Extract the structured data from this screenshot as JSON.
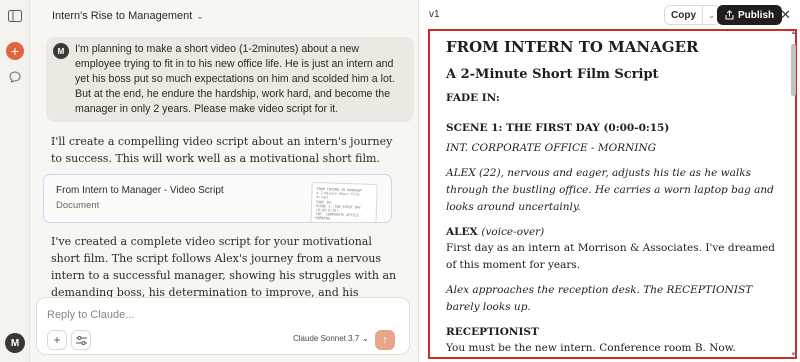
{
  "chat": {
    "title": "Intern's Rise to Management",
    "user_initial": "M",
    "user_message": "I'm planning to make a short video (1-2minutes) about a new employee trying to fit in to his new office life. He is just an intern and yet his boss put so much expectations on him and scolded him a lot. But at the end, he endure the hardship, work hard, and become the manager in only 2 years. Please make video script for it.",
    "response_1": "I'll create a compelling video script about an intern's journey to success. This will work well as a motivational short film.",
    "artifact_card": {
      "title": "From Intern to Manager - Video Script",
      "type": "Document"
    },
    "response_2": "I've created a complete video script for your motivational short film. The script follows Alex's journey from a nervous intern to a successful manager, showing his struggles with an demanding boss, his determination to improve, and his ultimate success."
  },
  "composer": {
    "placeholder": "Reply to Claude...",
    "model": "Claude Sonnet 3.7"
  },
  "rail": {
    "avatar_initial": "M"
  },
  "panel": {
    "version": "v1",
    "copy_label": "Copy",
    "publish_label": "Publish"
  },
  "script": {
    "title": "FROM INTERN TO MANAGER",
    "subtitle": "A 2-Minute Short Film Script",
    "fade_in": "FADE IN:",
    "scene1_heading": "SCENE 1: THE FIRST DAY (0:00-0:15)",
    "scene1_location": "INT. CORPORATE OFFICE - MORNING",
    "scene1_action1": "ALEX (22), nervous and eager, adjusts his tie as he walks through the bustling office. He carries a worn laptop bag and looks around uncertainly.",
    "alex_name": "ALEX",
    "alex_paren": "(voice-over)",
    "alex_line": "First day as an intern at Morrison & Associates. I've dreamed of this moment for years.",
    "scene1_action2": "Alex approaches the reception desk. The RECEPTIONIST barely looks up.",
    "receptionist_name": "RECEPTIONIST",
    "receptionist_line": "You must be the new intern. Conference room B. Now."
  }
}
